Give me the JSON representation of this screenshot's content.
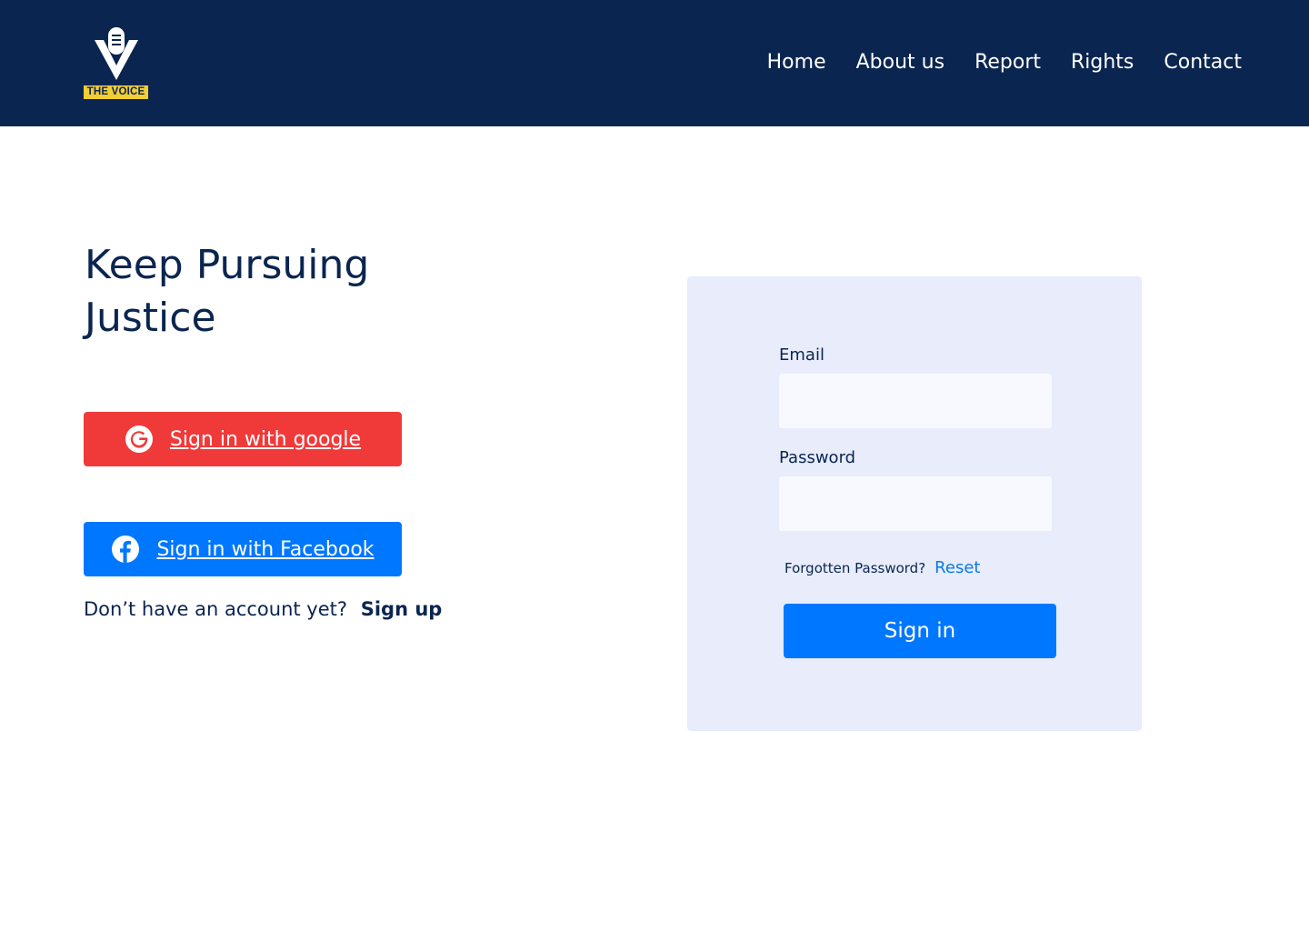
{
  "header": {
    "logo_text": "THE VOICE",
    "nav": [
      {
        "label": "Home"
      },
      {
        "label": "About us"
      },
      {
        "label": "Report"
      },
      {
        "label": "Rights"
      },
      {
        "label": "Contact"
      }
    ]
  },
  "hero": {
    "title": "Keep Pursuing Justice"
  },
  "social": {
    "google_label": "Sign in with google",
    "google_icon": "google-icon",
    "facebook_label": "Sign in with Facebook",
    "facebook_icon": "facebook-icon"
  },
  "signup": {
    "prompt": "Don’t have an account yet?",
    "link_label": "Sign up"
  },
  "login": {
    "email_label": "Email",
    "email_value": "",
    "password_label": "Password",
    "password_value": "",
    "forgot_text": "Forgotten Password?",
    "reset_label": "Reset",
    "signin_label": "Sign in"
  },
  "colors": {
    "navbar": "#0a2550",
    "logo_badge": "#f2cd34",
    "google_button": "#f03a3a",
    "primary_button": "#0077ff",
    "card_background": "#e8ecfb",
    "link": "#0a7ae3"
  }
}
